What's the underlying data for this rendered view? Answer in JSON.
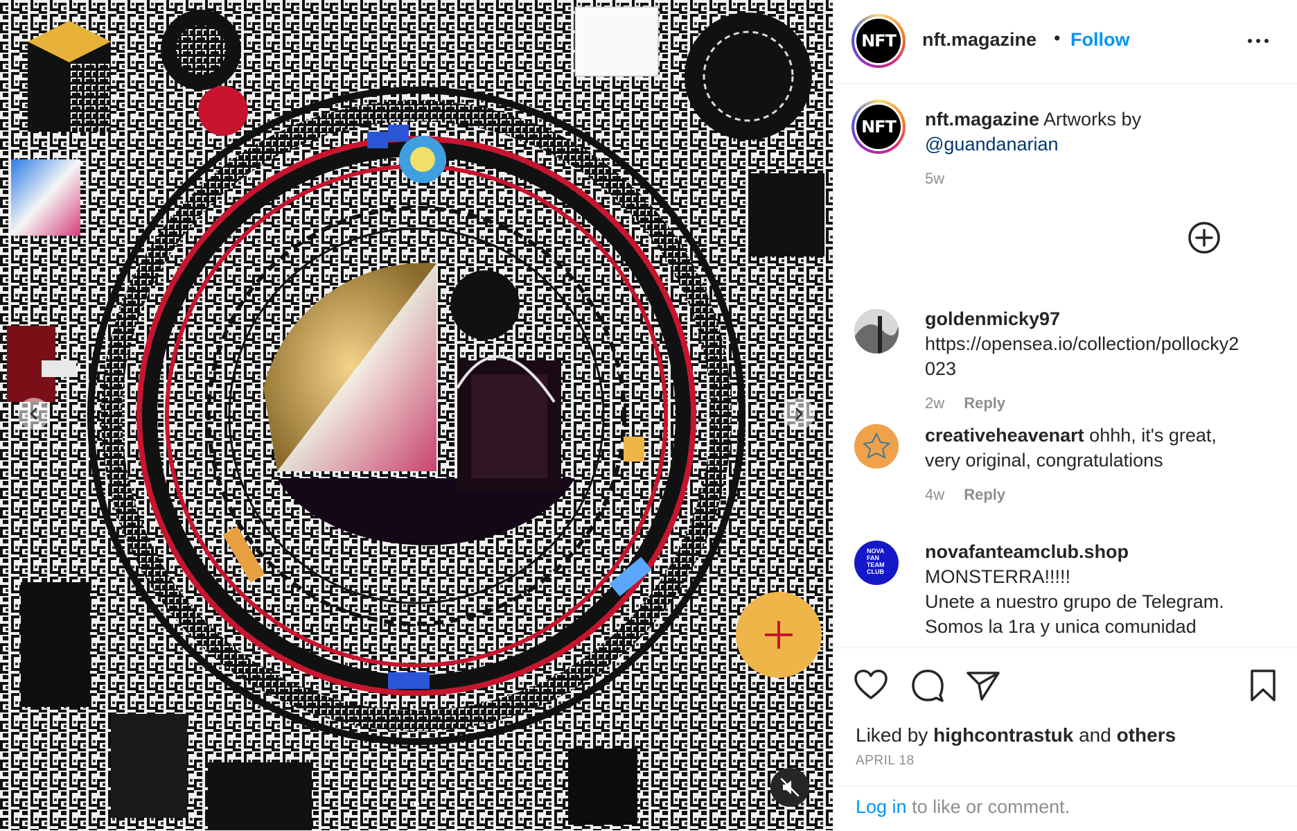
{
  "post": {
    "author": "nft.magazine",
    "separator": "•",
    "follow_label": "Follow",
    "avatar_text": "NFT",
    "caption_text": "Artworks by",
    "caption_mention": "@guandanarian",
    "caption_time": "5w"
  },
  "comments": [
    {
      "user": "goldenmicky97",
      "text_line1": "https://opensea.io/collection/pollocky2",
      "text_line2": "023",
      "time": "2w",
      "reply_label": "Reply"
    },
    {
      "user": "creativeheavenart",
      "text_line1": "ohhh, it's great,",
      "text_line2": "very original, congratulations",
      "time": "4w",
      "reply_label": "Reply"
    },
    {
      "user": "novafanteamclub.shop",
      "text_line1": "MONSTERRA!!!!!",
      "text_line2": "Unete a nuestro grupo de Telegram.",
      "text_line3": "Somos la 1ra y unica comunidad",
      "avatar_text": "NOVA FAN TEAM CLUB"
    }
  ],
  "engagement": {
    "liked_prefix": "Liked by",
    "liked_user": "highcontrastuk",
    "liked_and": "and",
    "liked_others": "others",
    "date": "APRIL 18"
  },
  "login": {
    "link": "Log in",
    "rest": "to like or comment."
  },
  "icons": {
    "like": "heart-icon",
    "comment": "comment-icon",
    "share": "paper-plane-icon",
    "save": "bookmark-icon",
    "more": "more-options-icon",
    "mute": "speaker-muted-icon",
    "load_more": "plus-circle-icon"
  },
  "colors": {
    "accent": "#0095f6",
    "mention": "#00376b",
    "muted_text": "#8e8e8e",
    "art_red": "#d4143c"
  }
}
